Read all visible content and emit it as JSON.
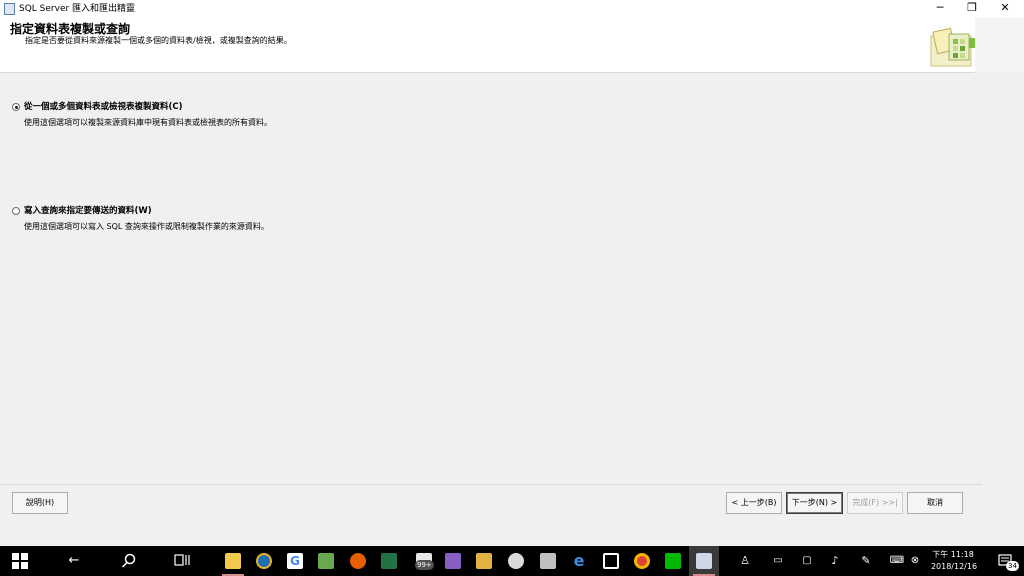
{
  "window": {
    "title": "SQL Server 匯入和匯出精靈",
    "minimize": "─",
    "restore": "❐",
    "close": "✕"
  },
  "banner": {
    "heading": "指定資料表複製或查詢",
    "subheading": "指定是否要從資料來源複製一個或多個的資料表/檢視，或複製查詢的結果。"
  },
  "options": [
    {
      "label": "從一個或多個資料表或檢視表複製資料(C)",
      "description": "使用這個選項可以複製來源資料庫中現有資料表或檢視表的所有資料。",
      "selected": true
    },
    {
      "label": "寫入查詢來指定要傳送的資料(W)",
      "description": "使用這個選項可以寫入 SQL 查詢來操作或限制複製作業的來源資料。",
      "selected": false
    }
  ],
  "buttons": {
    "help": "說明(H)",
    "back": "< 上一步(B)",
    "next": "下一步(N) >",
    "finish": "完成(F) >>|",
    "cancel": "取消"
  },
  "taskbar": {
    "badge": "99+",
    "time": "下午 11:18",
    "date": "2018/12/16",
    "notification_count": "34",
    "icons": [
      "windows-icon",
      "back-arrow-icon",
      "search-icon",
      "task-view-icon",
      "file-explorer-icon",
      "media-player-icon",
      "google-icon",
      "notepad-icon",
      "firefox-icon",
      "excel-icon",
      "mail-icon",
      "visual-studio-icon",
      "sql-tool-icon",
      "paint-icon",
      "paint-brush-icon",
      "edge-icon",
      "news-icon",
      "chrome-icon",
      "line-icon",
      "document-icon"
    ],
    "accent": "#d88b8b"
  }
}
